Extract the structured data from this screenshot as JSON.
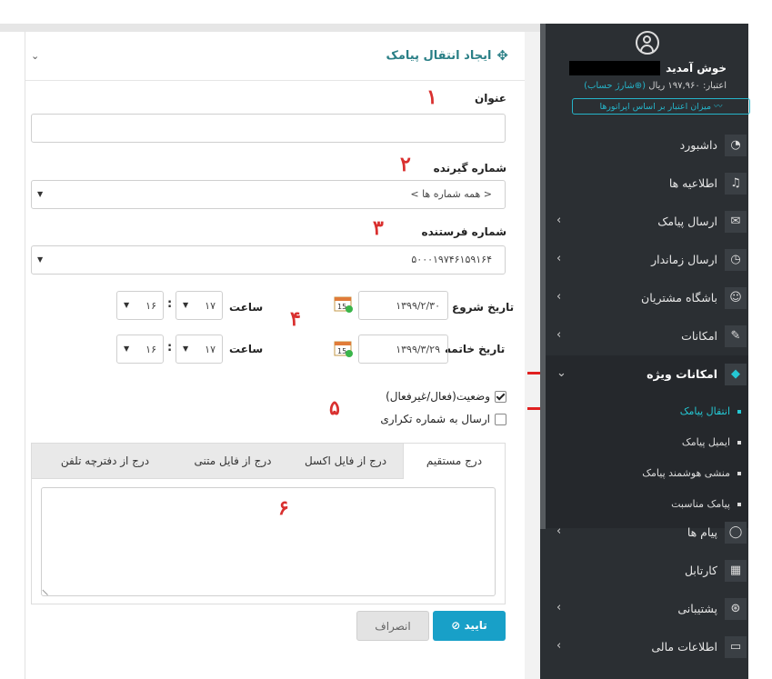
{
  "panel": {
    "title": "ایجاد انتقال پیامک",
    "fields": {
      "title_label": "عنوان",
      "title_value": "",
      "receiver_label": "شماره گیرنده",
      "receiver_value": "< همه شماره ها >",
      "sender_label": "شماره فرستنده",
      "sender_value": "۵۰۰۰۱۹۷۴۶۱۵۹۱۶۴"
    },
    "start": {
      "label": "تاریخ شروع",
      "date": "۱۳۹۹/۲/۳۰",
      "time_label": "ساعت",
      "hour": "۱۷",
      "minute": "۱۶",
      "colon": ":"
    },
    "end": {
      "label": "تاریخ خاتمه",
      "date": "۱۳۹۹/۳/۲۹",
      "time_label": "ساعت",
      "hour": "۱۷",
      "minute": "۱۶",
      "colon": ":"
    },
    "calendar_day": "15",
    "status_label": "وضعیت(فعال/غیرفعال)",
    "status_checked": true,
    "duplicate_label": "ارسال به شماره تکراری",
    "duplicate_checked": false,
    "tabs": [
      "درج مستقیم",
      "درج از فایل اکسل",
      "درج از فایل متنی",
      "درج از دفترچه تلفن"
    ],
    "active_tab": 0,
    "textarea_value": "",
    "confirm_label": "تایید",
    "cancel_label": "انصراف",
    "annotations": [
      "۱",
      "۲",
      "۳",
      "۴",
      "۵",
      "۶"
    ]
  },
  "sidebar": {
    "welcome": "خوش آمدید",
    "credit_prefix": "اعتبار: ۱۹۷,۹۶۰ ریال",
    "credit_link": "(⊕شارژ حساب)",
    "operator_button": "〰 میزان اعتبار بر اساس اپراتورها",
    "menu": [
      {
        "label": "داشبورد",
        "icon": "dashboard-icon",
        "glyph": "◔",
        "chevron": false
      },
      {
        "label": "اطلاعیه ها",
        "icon": "bell-icon",
        "glyph": "♫",
        "chevron": false
      },
      {
        "label": "ارسال پیامک",
        "icon": "envelope-icon",
        "glyph": "✉",
        "chevron": true
      },
      {
        "label": "ارسال زماندار",
        "icon": "clock-icon",
        "glyph": "◷",
        "chevron": true
      },
      {
        "label": "باشگاه مشتریان",
        "icon": "users-icon",
        "glyph": "☺",
        "chevron": true
      },
      {
        "label": "امکانات",
        "icon": "tools-icon",
        "glyph": "✎",
        "chevron": true
      },
      {
        "label": "امکانات ویژه",
        "icon": "diamond-icon",
        "glyph": "◆",
        "chevron": true,
        "active": true
      },
      {
        "label": "پیام ها",
        "icon": "chat-icon",
        "glyph": "◯",
        "chevron": true
      },
      {
        "label": "کارتابل",
        "icon": "grid-icon",
        "glyph": "▦",
        "chevron": false
      },
      {
        "label": "پشتیبانی",
        "icon": "support-icon",
        "glyph": "⊛",
        "chevron": true
      },
      {
        "label": "اطلاعات مالی",
        "icon": "folder-icon",
        "glyph": "▭",
        "chevron": true
      }
    ],
    "submenu": [
      {
        "label": "انتقال پیامک",
        "active": true
      },
      {
        "label": "ایمیل پیامک",
        "active": false
      },
      {
        "label": "منشی هوشمند پیامک",
        "active": false
      },
      {
        "label": "پیامک مناسبت",
        "active": false
      }
    ]
  },
  "colors": {
    "accent": "#25c8d4",
    "primary_button": "#18a0c8",
    "annotation": "#d9302f",
    "sidebar_bg": "#2b2f33"
  }
}
